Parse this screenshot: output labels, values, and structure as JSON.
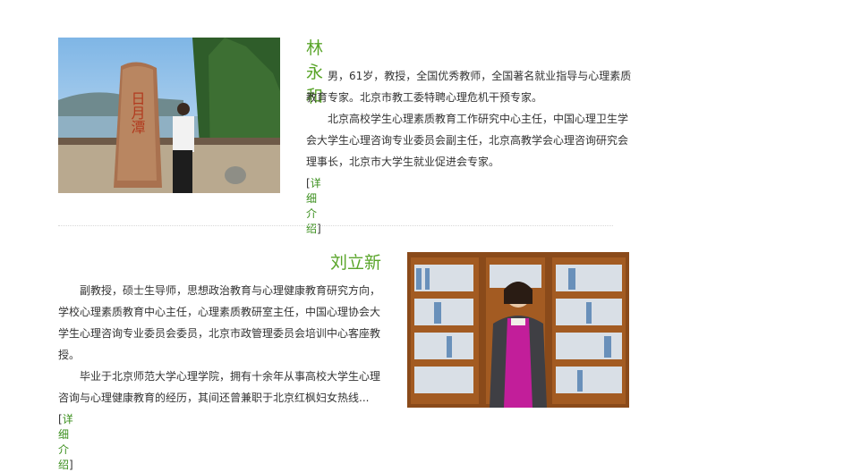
{
  "profiles": [
    {
      "name": "林永和",
      "paragraphs": [
        "男，61岁，教授，全国优秀教师，全国著名就业指导与心理素质教育专家。北京市教工委特聘心理危机干预专家。",
        "北京高校学生心理素质教育工作研究中心主任，中国心理卫生学会大学生心理咨询专业委员会副主任，北京高教学会心理咨询研究会理事长，北京市大学生就业促进会专家。"
      ],
      "more_open": "[",
      "more_label": "详细介绍",
      "more_close": "]",
      "photo_text": "日月潭"
    },
    {
      "name": "刘立新",
      "paragraphs": [
        "副教授，硕士生导师，思想政治教育与心理健康教育研究方向，学校心理素质教育中心主任，心理素质教研室主任，中国心理协会大学生心理咨询专业委员会委员，北京市政管理委员会培训中心客座教授。",
        "毕业于北京师范大学心理学院，拥有十余年从事高校大学生心理咨询与心理健康教育的经历，其间还曾兼职于北京红枫妇女热线..."
      ],
      "more_open": "[",
      "more_label": "详细介绍",
      "more_close": "]"
    }
  ],
  "colors": {
    "accent": "#5aa52a",
    "link": "#3b8f1d",
    "text": "#333333"
  }
}
